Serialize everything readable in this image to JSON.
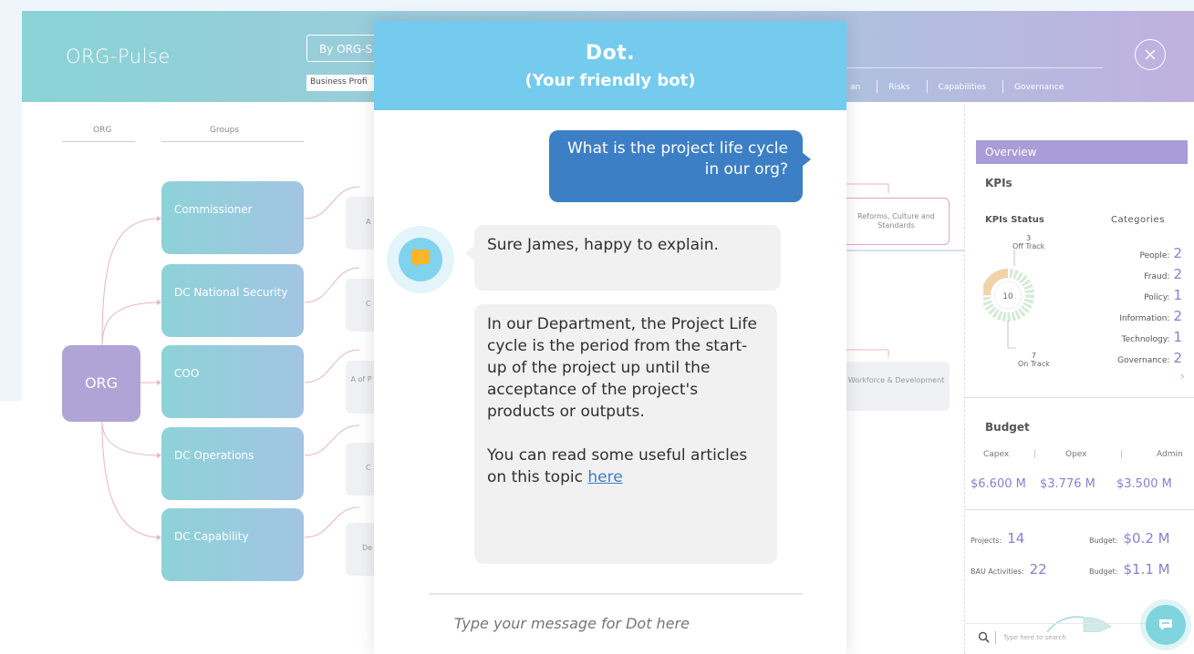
{
  "app": {
    "logo": "ORG-Pulse",
    "view_button": "By ORG-S",
    "view_input": "Business Profi",
    "nav_tabs": [
      "an",
      "Risks",
      "Capabilities",
      "Governance"
    ]
  },
  "org_chart": {
    "col_org": "ORG",
    "col_groups": "Groups",
    "root": "ORG",
    "groups": [
      "Commissioner",
      "DC National Security",
      "COO",
      "DC Operations",
      "DC Capability"
    ],
    "node_reforms": "Reforms, Culture and Standards",
    "node_workforce": "Workforce & Development",
    "ghost_a": "A",
    "ghost_c": "C",
    "ghost_a2": "A of P",
    "ghost_c2": "C",
    "ghost_de": "De"
  },
  "overview": {
    "title": "Overview",
    "kpis": "KPIs",
    "kpis_status": "KPIs Status",
    "categories_label": "Categories",
    "off_track_count": "3",
    "off_track_label": "Off Track",
    "on_track_count": "7",
    "on_track_label": "On Track",
    "total": "10",
    "categories": [
      {
        "name": "People:",
        "count": "2"
      },
      {
        "name": "Fraud:",
        "count": "2"
      },
      {
        "name": "Policy:",
        "count": "1"
      },
      {
        "name": "Information:",
        "count": "2"
      },
      {
        "name": "Technology:",
        "count": "1"
      },
      {
        "name": "Governance:",
        "count": "2"
      }
    ],
    "budget_title": "Budget",
    "budget_labels": [
      "Capex",
      "Opex",
      "Admin"
    ],
    "budget_values": [
      "$6.600 M",
      "$3.776 M",
      "$3.500 M"
    ],
    "projects_label": "Projects:",
    "projects_value": "14",
    "projects_budget_label": "Budget:",
    "projects_budget_value": "$0.2 M",
    "bau_label": "BAU Activities:",
    "bau_value": "22",
    "bau_budget_label": "Budget:",
    "bau_budget_value": "$1.1 M",
    "search_placeholder": "Type here to search"
  },
  "chat": {
    "bot_name": "Dot.",
    "bot_tagline": "(Your friendly bot)",
    "user_message": "What is the project life cycle in our org?",
    "bot_reply_1": "Sure James, happy to explain.",
    "bot_reply_2": "In our Department, the Project Life cycle is the period from the start-up of the project up until the acceptance of the project's products or outputs.",
    "bot_reply_3": "You can read some useful articles on this topic",
    "bot_link": "here",
    "input_placeholder": "Type your message for Dot here"
  },
  "colors": {
    "header_gradient_start": "#8ad3d6",
    "header_gradient_end": "#c0b1df",
    "chat_header": "#74cbed",
    "user_bubble": "#3c7fc5",
    "accent_purple": "#8a7fcf",
    "org_root": "#b0a3d5"
  }
}
